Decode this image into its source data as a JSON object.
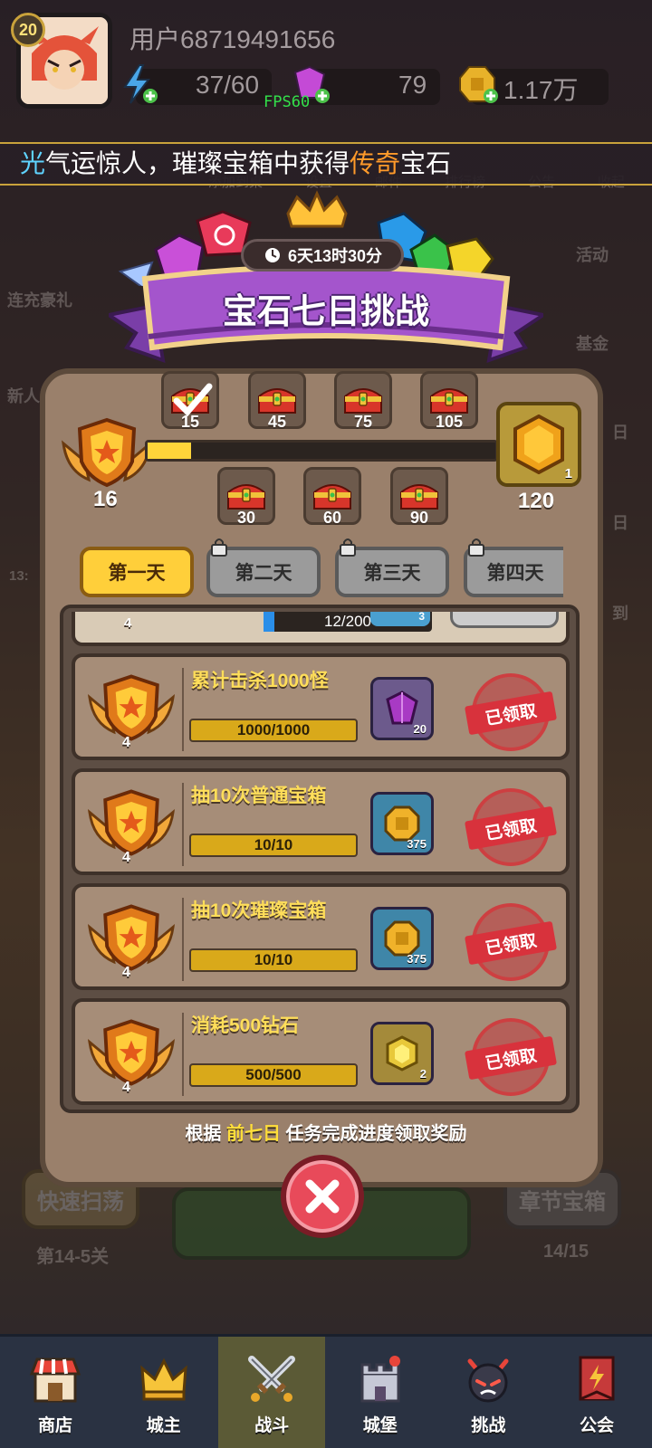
{
  "player": {
    "level": "20",
    "username": "用户68719491656"
  },
  "resources": {
    "energy": "37/60",
    "gems": "79",
    "coins": "1.17万"
  },
  "fps": "FPS60",
  "ticker": {
    "prefix": "光",
    "text1": "气运惊人，璀璨宝箱中获得",
    "highlight": "传奇",
    "text2": "宝石"
  },
  "side_menu": {
    "left1": "连充豪礼",
    "left2": "新人",
    "left3": "13:",
    "right1": "活动",
    "right2": "基金",
    "right3": "日",
    "right4": "日",
    "right5": "到"
  },
  "top_menu_faded": [
    "添加到桌",
    "设置",
    "邮件",
    "排行榜",
    "公告",
    "收起"
  ],
  "challenge": {
    "title": "宝石七日挑战",
    "timer": "6天13时30分",
    "medal_count": "16",
    "progress_fraction": 0.125,
    "milestones_top": [
      "15",
      "45",
      "75",
      "105"
    ],
    "milestones_bottom": [
      "30",
      "60",
      "90"
    ],
    "final_reward": {
      "count": "1",
      "points": "120"
    }
  },
  "tabs": [
    {
      "label": "第一天",
      "active": true
    },
    {
      "label": "第二天",
      "locked": true
    },
    {
      "label": "第三天",
      "locked": true
    },
    {
      "label": "第四天",
      "locked": true
    }
  ],
  "partial_row": {
    "medal": "4",
    "progress": "12/200",
    "reward_count": "3"
  },
  "tasks": [
    {
      "title": "累计击杀1000怪",
      "medal": "4",
      "progress": "1000/1000",
      "fraction": 1.0,
      "reward": "gem-icon",
      "reward_count": "20",
      "status": "已领取"
    },
    {
      "title": "抽10次普通宝箱",
      "medal": "4",
      "progress": "10/10",
      "fraction": 1.0,
      "reward": "coin-icon",
      "reward_count": "375",
      "status": "已领取"
    },
    {
      "title": "抽10次璀璨宝箱",
      "medal": "4",
      "progress": "10/10",
      "fraction": 1.0,
      "reward": "coin-icon",
      "reward_count": "375",
      "status": "已领取"
    },
    {
      "title": "消耗500钻石",
      "medal": "4",
      "progress": "500/500",
      "fraction": 1.0,
      "reward": "gold-gem-icon",
      "reward_count": "2",
      "status": "已领取"
    }
  ],
  "footer": {
    "pre": "根据 ",
    "highlight": "前七日",
    "post": " 任务完成进度领取奖励"
  },
  "bg_buttons": {
    "sweep": "快速扫荡",
    "stage": "第14-5关",
    "chapter_chest": "章节宝箱",
    "stars": "14/15"
  },
  "bottom_nav": [
    {
      "label": "商店",
      "icon": "shop-icon"
    },
    {
      "label": "城主",
      "icon": "crown-icon"
    },
    {
      "label": "战斗",
      "icon": "swords-icon",
      "active": true
    },
    {
      "label": "城堡",
      "icon": "castle-icon"
    },
    {
      "label": "挑战",
      "icon": "demon-icon"
    },
    {
      "label": "公会",
      "icon": "guild-icon"
    }
  ]
}
